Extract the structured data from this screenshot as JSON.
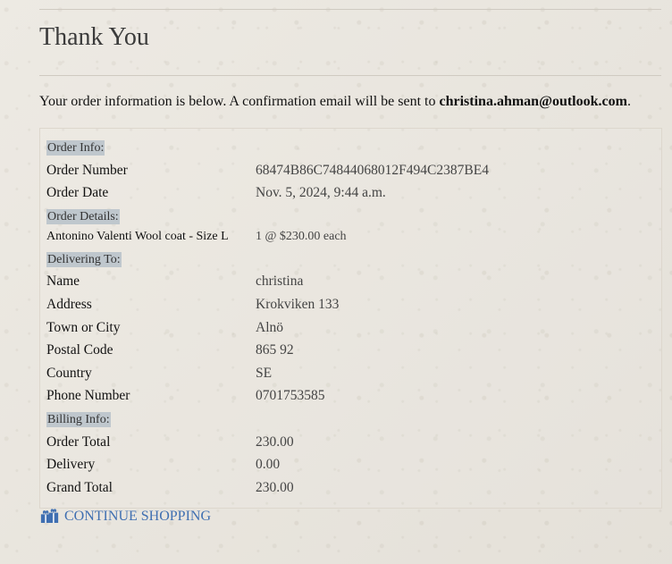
{
  "page": {
    "title": "Thank You",
    "intro_prefix": "Your order information is below. A confirmation email will be sent to ",
    "email": "christina.ahman@outlook.com",
    "intro_suffix": "."
  },
  "order_info": {
    "heading": "Order Info:",
    "rows": [
      {
        "label": "Order Number",
        "value": "68474B86C74844068012F494C2387BE4"
      },
      {
        "label": "Order Date",
        "value": "Nov. 5, 2024, 9:44 a.m."
      }
    ]
  },
  "order_details": {
    "heading": "Order Details:",
    "item": "Antonino Valenti Wool coat - Size L",
    "quantity_price": "1 @ $230.00 each"
  },
  "delivering_to": {
    "heading": "Delivering To:",
    "rows": [
      {
        "label": "Name",
        "value": "christina"
      },
      {
        "label": "Address",
        "value": "Krokviken 133"
      },
      {
        "label": "Town or City",
        "value": "Alnö"
      },
      {
        "label": "Postal Code",
        "value": "865 92"
      },
      {
        "label": "Country",
        "value": "SE"
      },
      {
        "label": "Phone Number",
        "value": "0701753585"
      }
    ]
  },
  "billing_info": {
    "heading": "Billing Info:",
    "rows": [
      {
        "label": "Order Total",
        "value": "230.00"
      },
      {
        "label": "Delivery",
        "value": "0.00"
      },
      {
        "label": "Grand Total",
        "value": "230.00"
      }
    ]
  },
  "continue_link": {
    "label": "CONTINUE SHOPPING",
    "icon": "gifts-icon",
    "color": "#3f6fb1"
  }
}
